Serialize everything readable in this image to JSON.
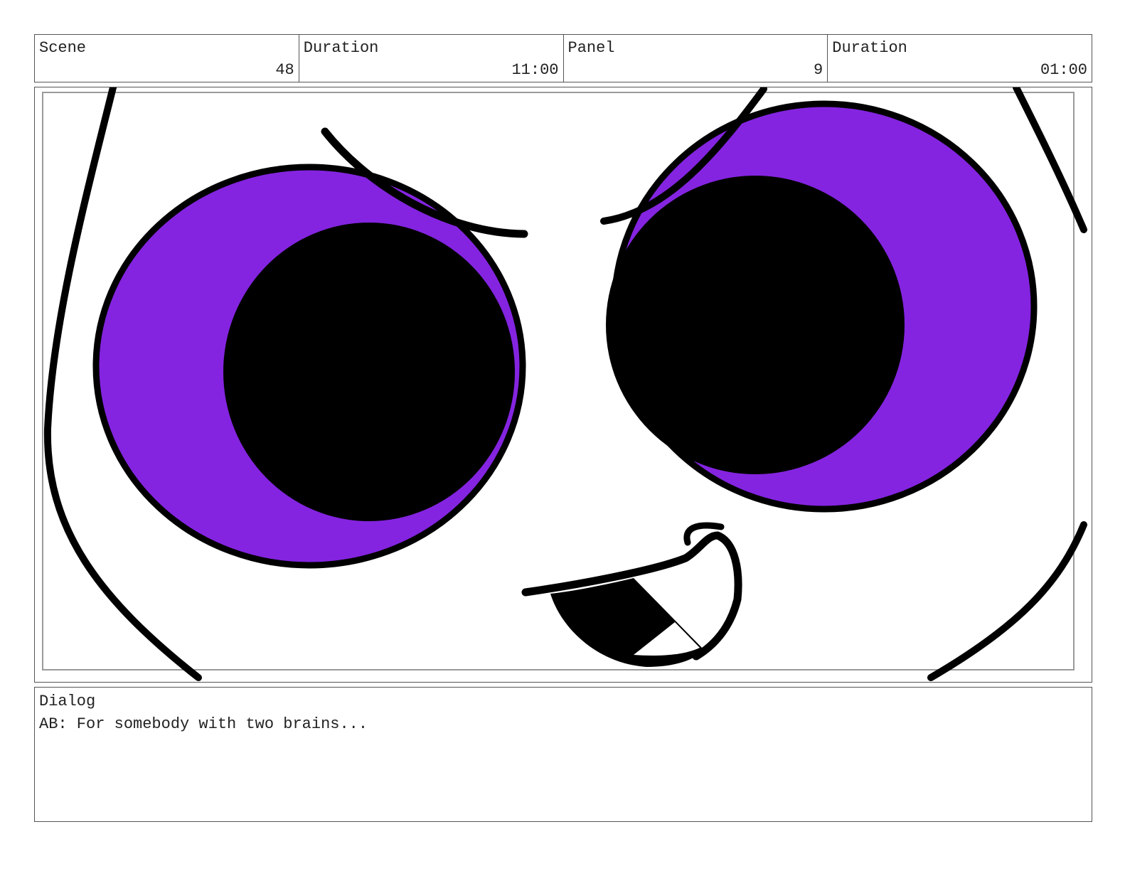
{
  "header": {
    "scene_label": "Scene",
    "scene_value": "48",
    "scene_duration_label": "Duration",
    "scene_duration_value": "11:00",
    "panel_label": "Panel",
    "panel_value": "9",
    "panel_duration_label": "Duration",
    "panel_duration_value": "01:00"
  },
  "artwork": {
    "iris_color": "#8424E0",
    "outline_color": "#000000",
    "safe_frame_color": "#9a9a9a"
  },
  "dialog": {
    "label": "Dialog",
    "text": "AB: For somebody with two brains..."
  }
}
